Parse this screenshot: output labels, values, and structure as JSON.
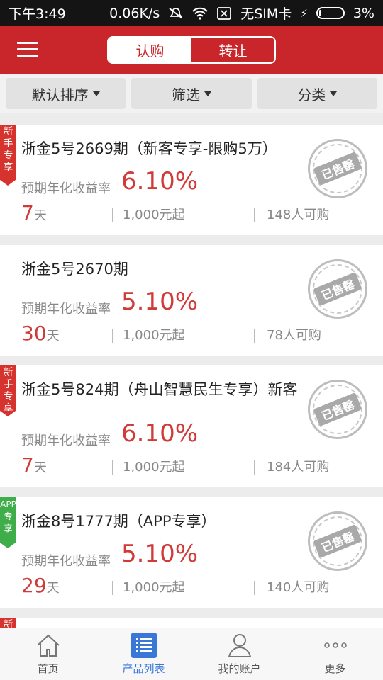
{
  "status": {
    "time": "下午3:49",
    "speed": "0.06K/s",
    "sim": "无SIM卡",
    "battery": "3%"
  },
  "header": {
    "tabs": [
      {
        "label": "认购",
        "active": true
      },
      {
        "label": "转让",
        "active": false
      }
    ]
  },
  "filters": [
    "默认排序",
    "筛选",
    "分类"
  ],
  "products": [
    {
      "badge": "新手专享",
      "badge_color": "#d6322e",
      "title": "浙金5号2669期（新客专享-限购5万）",
      "yield_label": "预期年化收益率",
      "yield": "6.10%",
      "days": "7",
      "days_unit": "天",
      "min": "1,000元起",
      "buyers": "148人可购",
      "stamp": "已售罄"
    },
    {
      "badge": "",
      "badge_color": "",
      "title": "浙金5号2670期",
      "yield_label": "预期年化收益率",
      "yield": "5.10%",
      "days": "30",
      "days_unit": "天",
      "min": "1,000元起",
      "buyers": "78人可购",
      "stamp": "已售罄"
    },
    {
      "badge": "新手专享",
      "badge_color": "#d6322e",
      "title": "浙金5号824期（舟山智慧民生专享）新客",
      "yield_label": "预期年化收益率",
      "yield": "6.10%",
      "days": "7",
      "days_unit": "天",
      "min": "1,000元起",
      "buyers": "184人可购",
      "stamp": "已售罄"
    },
    {
      "badge": "APP专享",
      "badge_color": "#3fad49",
      "title": "浙金8号1777期（APP专享）",
      "yield_label": "预期年化收益率",
      "yield": "5.10%",
      "days": "29",
      "days_unit": "天",
      "min": "1,000元起",
      "buyers": "140人可购",
      "stamp": "已售罄"
    }
  ],
  "partial_badge": "新",
  "bottom_nav": [
    {
      "label": "首页",
      "icon": "home-icon",
      "active": false
    },
    {
      "label": "产品列表",
      "icon": "list-icon",
      "active": true
    },
    {
      "label": "我的账户",
      "icon": "user-icon",
      "active": false
    },
    {
      "label": "更多",
      "icon": "more-icon",
      "active": false
    }
  ],
  "colors": {
    "brand": "#c8262a",
    "accent_blue": "#3a78d8",
    "yield_red": "#d03a38"
  }
}
